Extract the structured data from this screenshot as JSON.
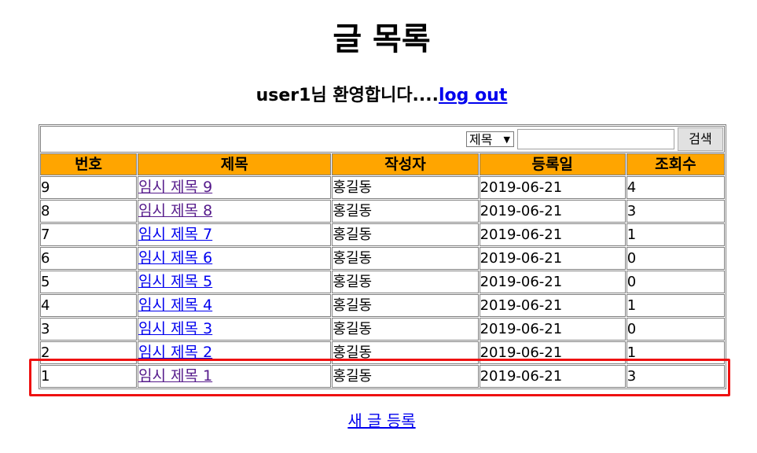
{
  "page": {
    "title": "글 목록",
    "welcome_text": "user1님 환영합니다....",
    "logout_label": "log out",
    "new_post_label": "새 글 등록"
  },
  "search": {
    "condition_selected": "제목",
    "keyword_value": "",
    "button_label": "검색"
  },
  "table": {
    "headers": [
      "번호",
      "제목",
      "작성자",
      "등록일",
      "조회수"
    ],
    "header_bg_color": "#ffa500",
    "rows": [
      {
        "no": "9",
        "title": "임시 제목 9",
        "writer": "홍길동",
        "date": "2019-06-21",
        "views": "4",
        "visited": true
      },
      {
        "no": "8",
        "title": "임시 제목 8",
        "writer": "홍길동",
        "date": "2019-06-21",
        "views": "3",
        "visited": true
      },
      {
        "no": "7",
        "title": "임시 제목 7",
        "writer": "홍길동",
        "date": "2019-06-21",
        "views": "1",
        "visited": false
      },
      {
        "no": "6",
        "title": "임시 제목 6",
        "writer": "홍길동",
        "date": "2019-06-21",
        "views": "0",
        "visited": false
      },
      {
        "no": "5",
        "title": "임시 제목 5",
        "writer": "홍길동",
        "date": "2019-06-21",
        "views": "0",
        "visited": false
      },
      {
        "no": "4",
        "title": "임시 제목 4",
        "writer": "홍길동",
        "date": "2019-06-21",
        "views": "1",
        "visited": false
      },
      {
        "no": "3",
        "title": "임시 제목 3",
        "writer": "홍길동",
        "date": "2019-06-21",
        "views": "0",
        "visited": false
      },
      {
        "no": "2",
        "title": "임시 제목 2",
        "writer": "홍길동",
        "date": "2019-06-21",
        "views": "1",
        "visited": false
      },
      {
        "no": "1",
        "title": "임시 제목 1",
        "writer": "홍길동",
        "date": "2019-06-21",
        "views": "3",
        "visited": true
      }
    ]
  },
  "highlight": {
    "target_row_no": "1",
    "color": "#ee1111"
  }
}
